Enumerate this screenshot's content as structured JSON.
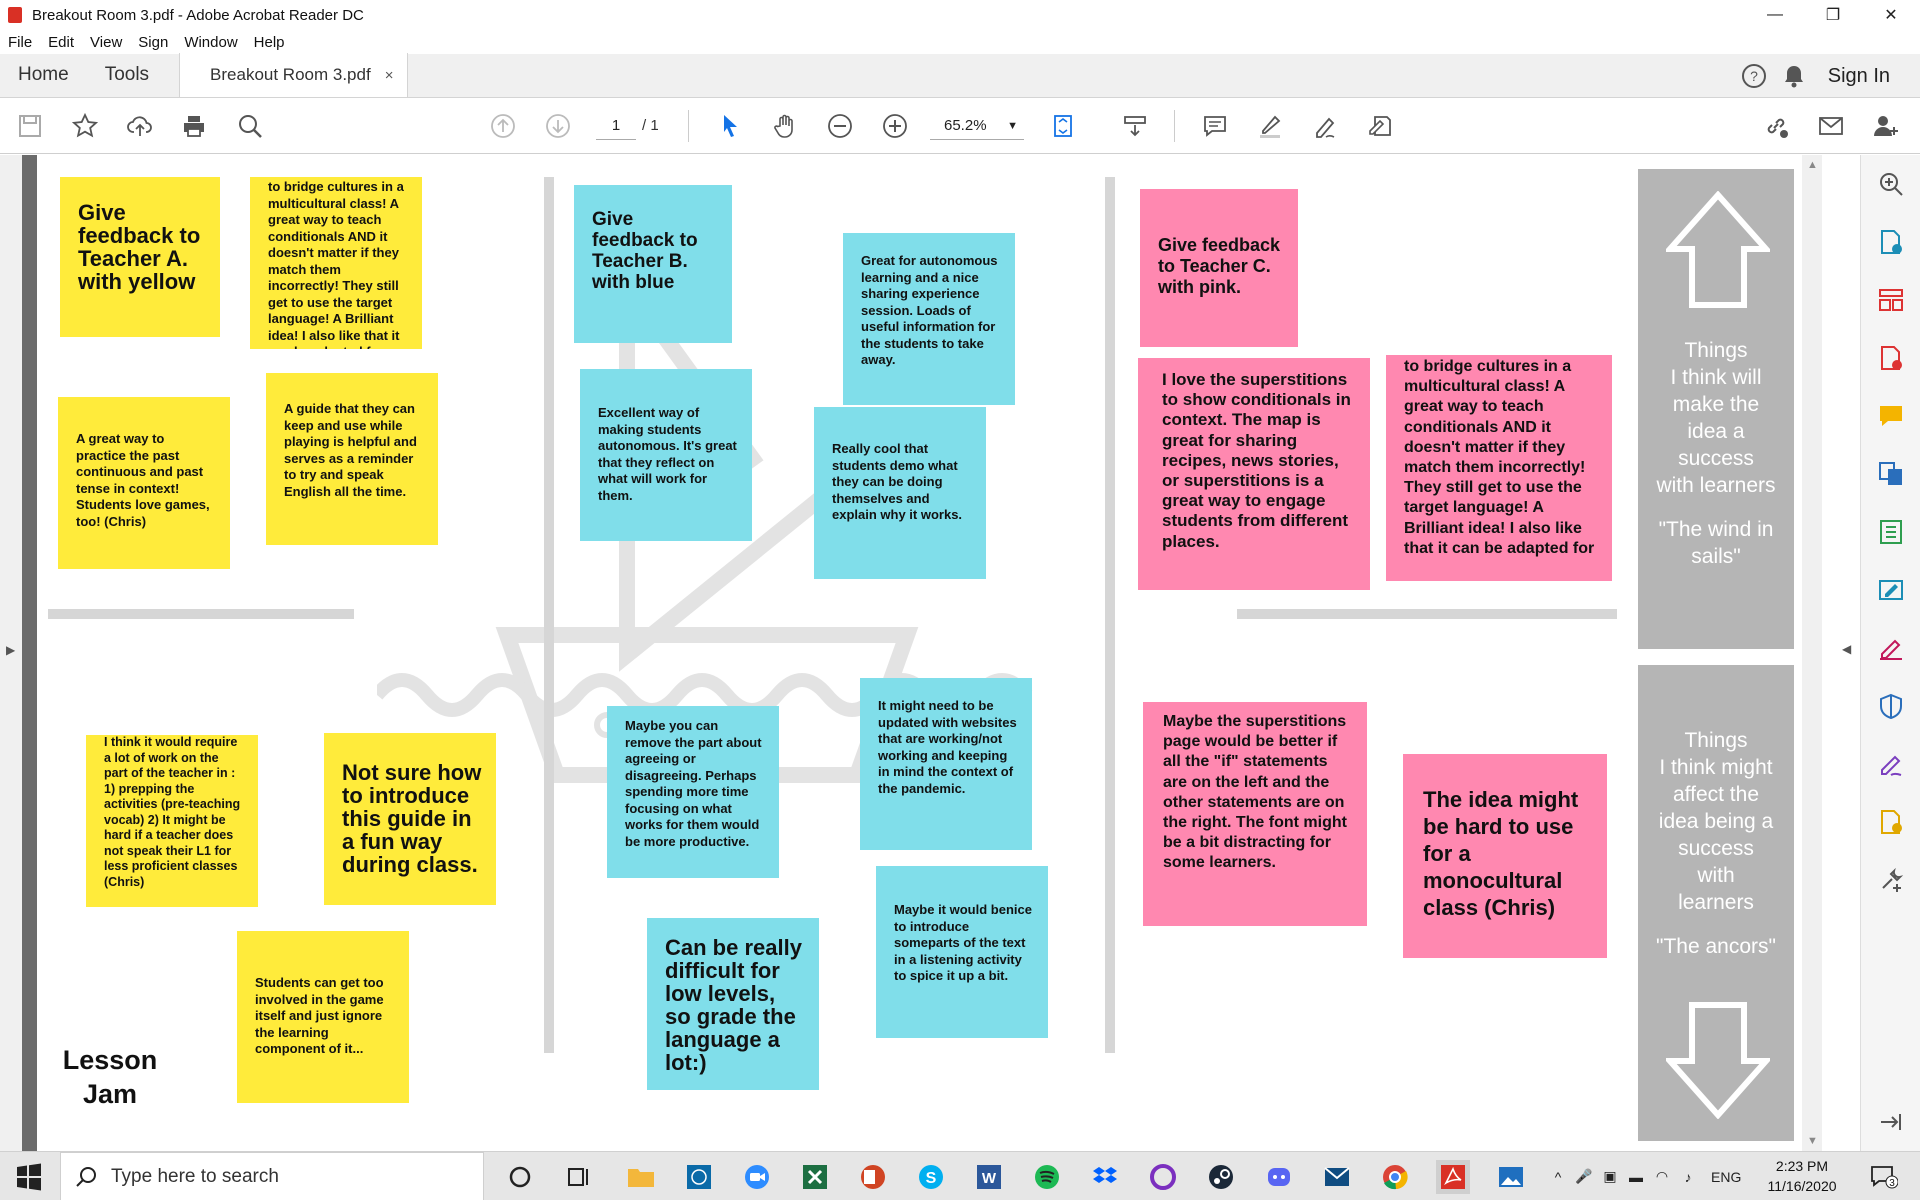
{
  "window": {
    "title": "Breakout Room 3.pdf - Adobe Acrobat Reader DC",
    "controls": {
      "minimize": "—",
      "restore": "❐",
      "close": "✕"
    }
  },
  "menu": [
    "File",
    "Edit",
    "View",
    "Sign",
    "Window",
    "Help"
  ],
  "tabs": {
    "home": "Home",
    "tools": "Tools",
    "document": "Breakout Room 3.pdf",
    "close": "×",
    "help": "?",
    "sign_in": "Sign In"
  },
  "toolbar": {
    "page_current": "1",
    "page_total": "/ 1",
    "zoom": "65.2%"
  },
  "board": {
    "notes": [
      {
        "id": "n1",
        "color": "yellow",
        "text": "Give feedback to Teacher A. with yellow"
      },
      {
        "id": "n2",
        "color": "yellow",
        "text": "to bridge cultures in a multicultural class! A great way to teach conditionals AND it doesn't matter if they match them incorrectly! They still get to use the target language! A Brilliant idea! I also like that it can be adapted for"
      },
      {
        "id": "n3",
        "color": "yellow",
        "text": "A great way to practice the past continuous and past tense in context! Students love games, too! (Chris)"
      },
      {
        "id": "n4",
        "color": "yellow",
        "text": "A guide that they can keep and use while playing is helpful and serves as a reminder to try and speak English all the time."
      },
      {
        "id": "n5",
        "color": "yellow",
        "text": "I think it would require a lot of work on the part of the teacher in : 1) prepping the activities (pre-teaching vocab) 2) It might be hard if a teacher does not speak their L1 for less proficient classes (Chris)"
      },
      {
        "id": "n6",
        "color": "yellow",
        "text": "Not sure how to introduce this guide in a fun way during class."
      },
      {
        "id": "n7",
        "color": "yellow",
        "text": "Students can get too involved in the game itself and just ignore the learning component of it..."
      },
      {
        "id": "n8",
        "color": "blue",
        "text": "Give feedback to Teacher B. with blue"
      },
      {
        "id": "n9",
        "color": "blue",
        "text": "Great for autonomous learning and a nice sharing experience session. Loads of useful information for the students to take away."
      },
      {
        "id": "n10",
        "color": "blue",
        "text": "Excellent way of making students autonomous.  It's great that they reflect on what will work for them."
      },
      {
        "id": "n11",
        "color": "blue",
        "text": "Really cool that students demo what they can be doing themselves and explain why it works."
      },
      {
        "id": "n12",
        "color": "blue",
        "text": "Maybe you can remove the part about agreeing or disagreeing. Perhaps spending more time focusing on what works for them would be more productive."
      },
      {
        "id": "n13",
        "color": "blue",
        "text": "It might need to be updated with websites that are working/not working and keeping in mind the context of the pandemic."
      },
      {
        "id": "n14",
        "color": "blue",
        "text": "Maybe it would benice to introduce someparts of the text in a listening activity to spice it up a bit."
      },
      {
        "id": "n15",
        "color": "blue",
        "text": "Can be really difficult for low levels, so grade the language a lot:)"
      },
      {
        "id": "n16",
        "color": "pink",
        "text": "Give feedback to Teacher C. with pink."
      },
      {
        "id": "n17",
        "color": "pink",
        "text": "I love the superstitions to show conditionals in context.  The map is great for sharing recipes, news stories, or superstitions is a great way to engage students from different places."
      },
      {
        "id": "n18",
        "color": "pink",
        "text": "to bridge cultures in a multicultural class! A great way to teach conditionals AND it doesn't matter if they match them incorrectly! They still get to use the target language! A Brilliant idea! I also like that it can be adapted for"
      },
      {
        "id": "n19",
        "color": "pink",
        "text": "Maybe the superstitions page would be better if all the \"if\" statements are on the left and the other statements are on the right.  The font might be a bit distracting for some learners."
      },
      {
        "id": "n20",
        "color": "pink",
        "text": "The idea might be hard to use for a monocultural class (Chris)"
      }
    ],
    "side_top": [
      "Things",
      "I think will",
      "make the",
      "idea a",
      "success",
      "with learners",
      "",
      "\"The wind in",
      "sails\""
    ],
    "side_bottom": [
      "Things",
      "I think might",
      "affect the",
      "idea being a",
      "success",
      "with",
      "learners",
      "",
      "\"The ancors\""
    ],
    "lesson_jam": [
      "Lesson",
      "Jam"
    ]
  },
  "taskbar": {
    "search_placeholder": "Type here to search",
    "language": "ENG",
    "time": "2:23 PM",
    "date": "11/16/2020",
    "notifications": "3"
  },
  "colors": {
    "yellow": "#ffeb3b",
    "blue": "#80deea",
    "pink": "#ff88b0",
    "side_box": "#b5b5b5",
    "acrobat_red": "#d93025"
  }
}
